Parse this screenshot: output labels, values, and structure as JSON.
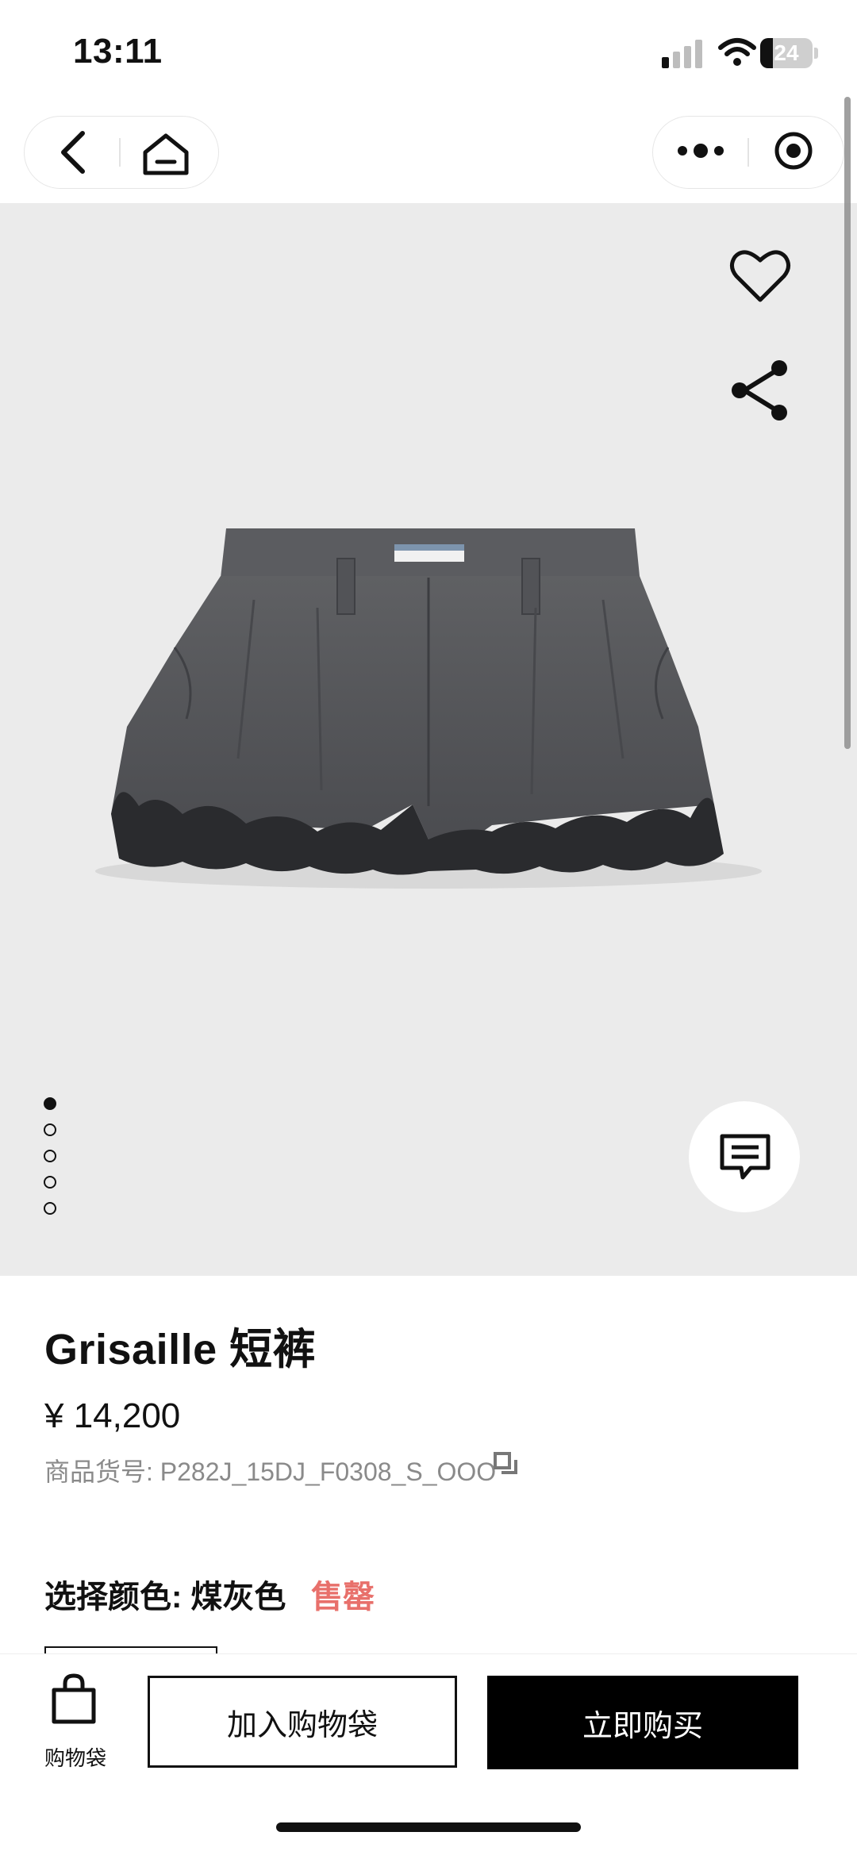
{
  "status_bar": {
    "time": "13:11",
    "battery_level": "24"
  },
  "product": {
    "title": "Grisaille 短裤",
    "price": "¥ 14,200",
    "sku_label": "商品货号: P282J_15DJ_F0308_S_OOO",
    "color_label": "选择颜色: 煤灰色",
    "availability": "售罄",
    "image_count": 5,
    "active_image": 1
  },
  "bottom_bar": {
    "bag_label": "购物袋",
    "add_to_bag": "加入购物袋",
    "buy_now": "立即购买"
  },
  "icons": [
    "signal-icon",
    "wifi-icon",
    "battery-icon",
    "back-icon",
    "home-icon",
    "more-icon",
    "close-miniprogram-icon",
    "heart-icon",
    "share-icon",
    "chat-icon",
    "copy-icon",
    "shopping-bag-icon"
  ],
  "colors": {
    "sold_out": "#e8706b",
    "gallery_bg": "#ebebeb",
    "primary": "#000000"
  }
}
